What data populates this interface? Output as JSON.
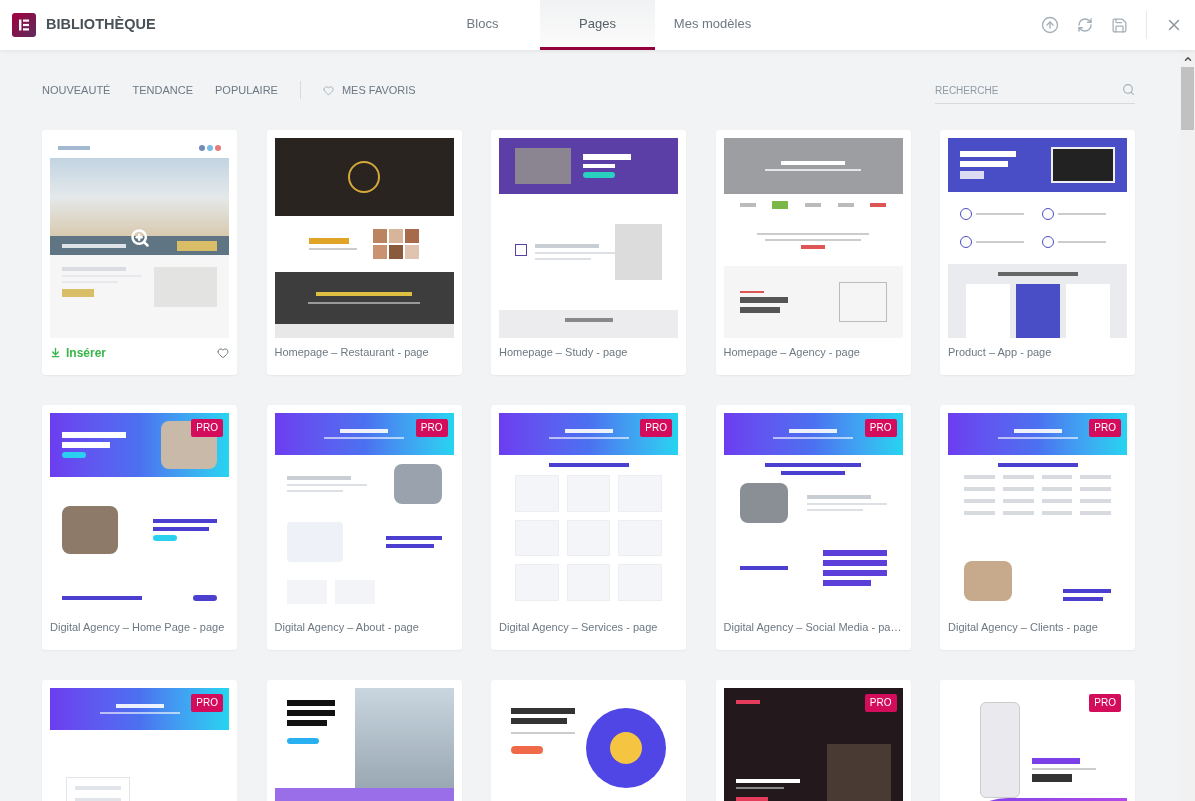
{
  "header": {
    "title": "BIBLIOTHÈQUE",
    "tabs": [
      {
        "label": "Blocs",
        "selected": false
      },
      {
        "label": "Pages",
        "selected": true
      },
      {
        "label": "Mes modèles",
        "selected": false
      }
    ]
  },
  "filters": [
    {
      "label": "NOUVEAUTÉ",
      "selected": false
    },
    {
      "label": "TENDANCE",
      "selected": false
    },
    {
      "label": "POPULAIRE",
      "selected": false
    }
  ],
  "favorites_filter": {
    "label": "MES FAVORIS",
    "selected": false
  },
  "search": {
    "placeholder": "RECHERCHE"
  },
  "templates": [
    {
      "kind": "hovered",
      "action": "Insérer",
      "favorite": false
    },
    {
      "kind": "default",
      "title": "Homepage – Restaurant - page"
    },
    {
      "kind": "default",
      "title": "Homepage – Study - page"
    },
    {
      "kind": "default",
      "title": "Homepage – Agency - page"
    },
    {
      "kind": "default",
      "title": "Product – App - page"
    },
    {
      "kind": "default",
      "title": "Digital Agency – Home Page - page",
      "badge": "PRO"
    },
    {
      "kind": "default",
      "title": "Digital Agency – About - page",
      "badge": "PRO"
    },
    {
      "kind": "default",
      "title": "Digital Agency – Services - page",
      "badge": "PRO"
    },
    {
      "kind": "default",
      "title": "Digital Agency – Social Media - pa…",
      "badge": "PRO"
    },
    {
      "kind": "default",
      "title": "Digital Agency – Clients - page",
      "badge": "PRO"
    },
    {
      "kind": "default",
      "badge": "PRO"
    },
    {
      "kind": "default"
    },
    {
      "kind": "default"
    },
    {
      "kind": "default",
      "badge": "PRO"
    },
    {
      "kind": "default",
      "badge": "PRO"
    }
  ]
}
